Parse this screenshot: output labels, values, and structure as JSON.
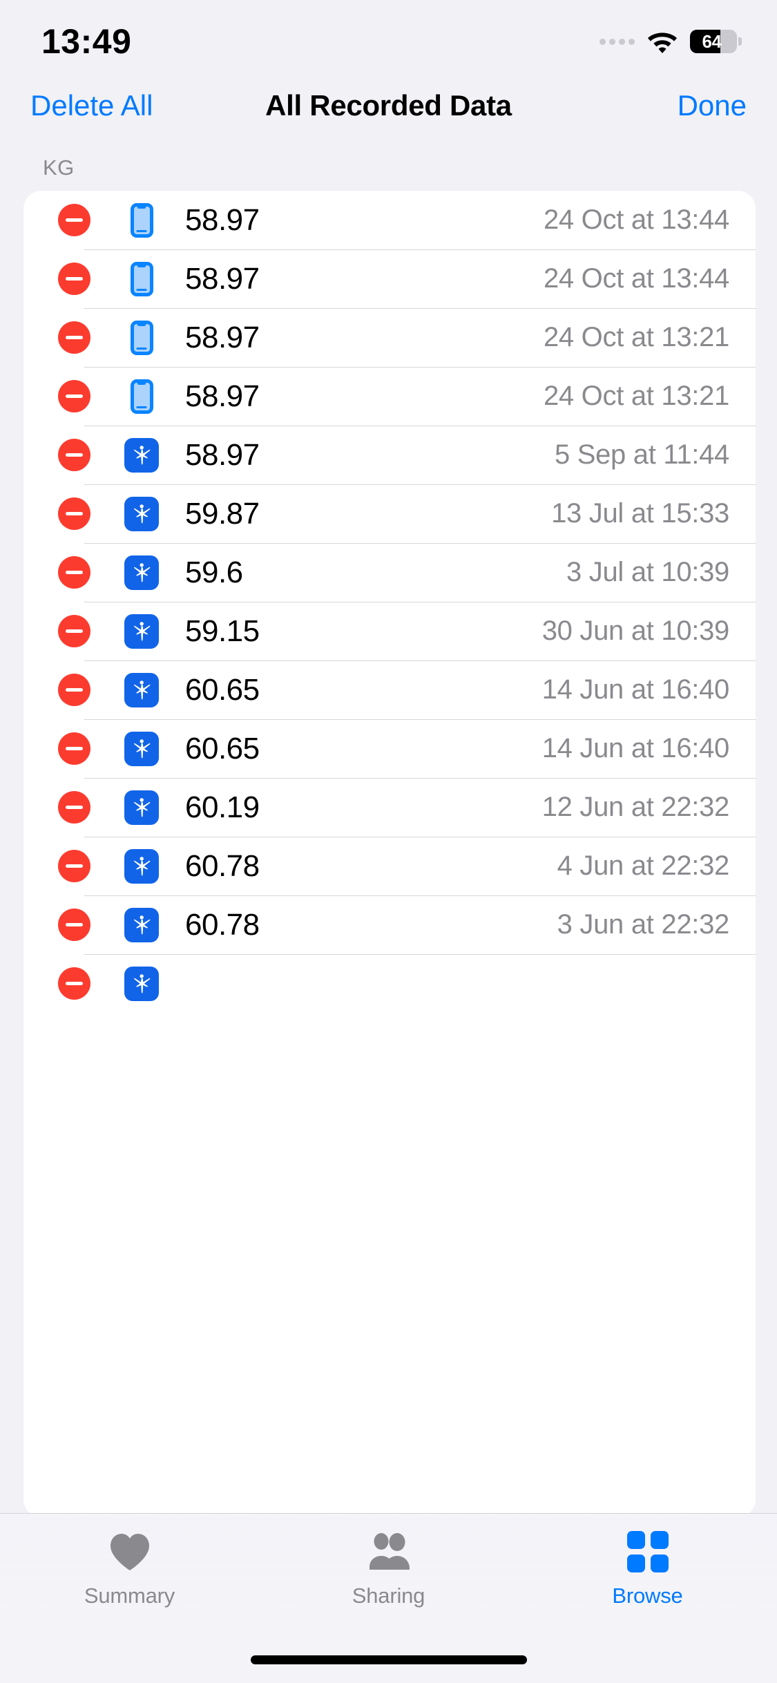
{
  "status_bar": {
    "time": "13:49",
    "signal_icon": "signal-dots-icon",
    "wifi_icon": "wifi-icon",
    "battery_percent": "64",
    "battery_fill_ratio": 0.64,
    "battery_icon": "battery-icon"
  },
  "nav_bar": {
    "left_button": "Delete All",
    "title": "All Recorded Data",
    "right_button": "Done",
    "accent_color": "#007aff"
  },
  "section": {
    "header": "KG"
  },
  "list": {
    "delete_icon": "minus-circle-icon",
    "rows": [
      {
        "source_icon": "iphone-icon",
        "value": "58.97",
        "date": "24 Oct at 13:44"
      },
      {
        "source_icon": "iphone-icon",
        "value": "58.97",
        "date": "24 Oct at 13:44"
      },
      {
        "source_icon": "iphone-icon",
        "value": "58.97",
        "date": "24 Oct at 13:21"
      },
      {
        "source_icon": "iphone-icon",
        "value": "58.97",
        "date": "24 Oct at 13:21"
      },
      {
        "source_icon": "fitness-app-icon",
        "value": "58.97",
        "date": "5 Sep at 11:44"
      },
      {
        "source_icon": "fitness-app-icon",
        "value": "59.87",
        "date": "13 Jul at 15:33"
      },
      {
        "source_icon": "fitness-app-icon",
        "value": "59.6",
        "date": "3 Jul at 10:39"
      },
      {
        "source_icon": "fitness-app-icon",
        "value": "59.15",
        "date": "30 Jun at 10:39"
      },
      {
        "source_icon": "fitness-app-icon",
        "value": "60.65",
        "date": "14 Jun at 16:40"
      },
      {
        "source_icon": "fitness-app-icon",
        "value": "60.65",
        "date": "14 Jun at 16:40"
      },
      {
        "source_icon": "fitness-app-icon",
        "value": "60.19",
        "date": "12 Jun at 22:32"
      },
      {
        "source_icon": "fitness-app-icon",
        "value": "60.78",
        "date": "4 Jun at 22:32"
      },
      {
        "source_icon": "fitness-app-icon",
        "value": "60.78",
        "date": "3 Jun at 22:32"
      },
      {
        "source_icon": "fitness-app-icon",
        "value": "",
        "date": ""
      }
    ]
  },
  "tab_bar": {
    "tabs": [
      {
        "label": "Summary",
        "icon": "heart-icon",
        "active": false
      },
      {
        "label": "Sharing",
        "icon": "people-icon",
        "active": false
      },
      {
        "label": "Browse",
        "icon": "grid-icon",
        "active": true
      }
    ],
    "active_color": "#007aff",
    "inactive_color": "#8a8a8e"
  }
}
